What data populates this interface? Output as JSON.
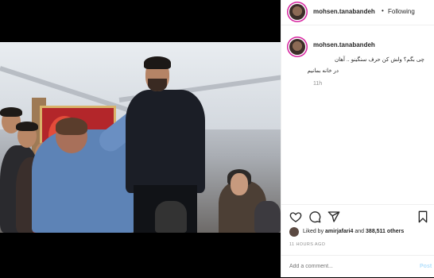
{
  "post": {
    "header": {
      "username": "mohsen.tanabandeh",
      "separator": "•",
      "follow_label": "Following"
    },
    "caption": {
      "username": "mohsen.tanabandeh",
      "line1": "چی بگم؟ ولش کن حرف سنگینو .. آهان",
      "line2": "در خانه بمانیم",
      "time": "11h"
    },
    "likes": {
      "user": "amirjafari4",
      "middle": " and ",
      "count": "388,511 others"
    },
    "time_ago": "11 HOURS AGO",
    "comment_input": {
      "placeholder": "Add a comment..."
    },
    "post_button": "Post",
    "icons": {
      "like": "heart-icon",
      "comment": "comment-bubble-icon",
      "share": "share-icon",
      "save": "bookmark-icon"
    },
    "colors": {
      "border": "#efefef",
      "muted": "#8e8e8e",
      "post_button": "#b2dffc",
      "story_ring": "#d6249f"
    }
  }
}
